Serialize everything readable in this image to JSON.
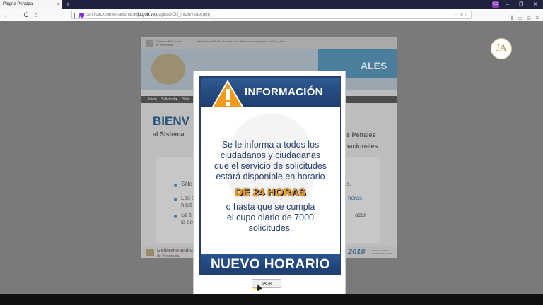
{
  "browser": {
    "tab_title": "Página Principal",
    "tab_close": "×",
    "new_tab": "+",
    "url_prefix": "certificacioninternacional.",
    "url_domain": "mijp.gob.ve",
    "url_suffix": "/paginas/CU_inicio/index.php",
    "url_actions": "··· ◎ ☆",
    "profile_badge": "GO",
    "window_min": "–",
    "window_max": "❐",
    "window_close": "✕",
    "nav_back": "←",
    "nav_forward": "→",
    "nav_reload": "C",
    "nav_home": "⌂",
    "tool_icons": [
      "⫼",
      "▭",
      "☺",
      "≡"
    ]
  },
  "page": {
    "gov_text": "Gobierno Bolivariano de Venezuela",
    "ministry_text": "Ministerio del Poder Popular para Relaciones Interiores, Justicia y Paz",
    "banner_text": "ALES",
    "menu": [
      "Inicio",
      "Solicitud ▾",
      "Solic"
    ],
    "welcome": "BIENV",
    "subtitle_left": "al Sistema",
    "subtitle_right_1": "es Penales",
    "subtitle_right_2": "nacionales",
    "bullets": [
      {
        "text": "Sólo",
        "right": "es."
      },
      {
        "text": "Las s",
        "text2": "hast",
        "right": "horas"
      },
      {
        "text": "Se ti",
        "text2": "la so",
        "right": "azar"
      }
    ],
    "footer_logo": "Gobierno Bolivar",
    "footer_logo_2": "de Venezuela",
    "footer_year": "2018",
    "footer_small": "PATRIA SEGURA SABEMOS VENCER"
  },
  "avatar": {
    "initials": "JA"
  },
  "modal": {
    "heading": "INFORMACIÓN",
    "body_lines": [
      "Se le informa a todos los",
      "ciudadanos y ciudadanas",
      "que el servicio de solicitudes",
      "estará disponible en horario"
    ],
    "highlight": "DE 24 HORAS",
    "body_lines_2": [
      "o hasta que se cumpla",
      "el cupo diario de 7000",
      "solicitudes."
    ],
    "footer": "NUEVO HORARIO",
    "button": "SALIR"
  },
  "colors": {
    "modal_blue": "#24406e",
    "highlight_orange": "#f29b19",
    "text_blue": "#27416c"
  }
}
